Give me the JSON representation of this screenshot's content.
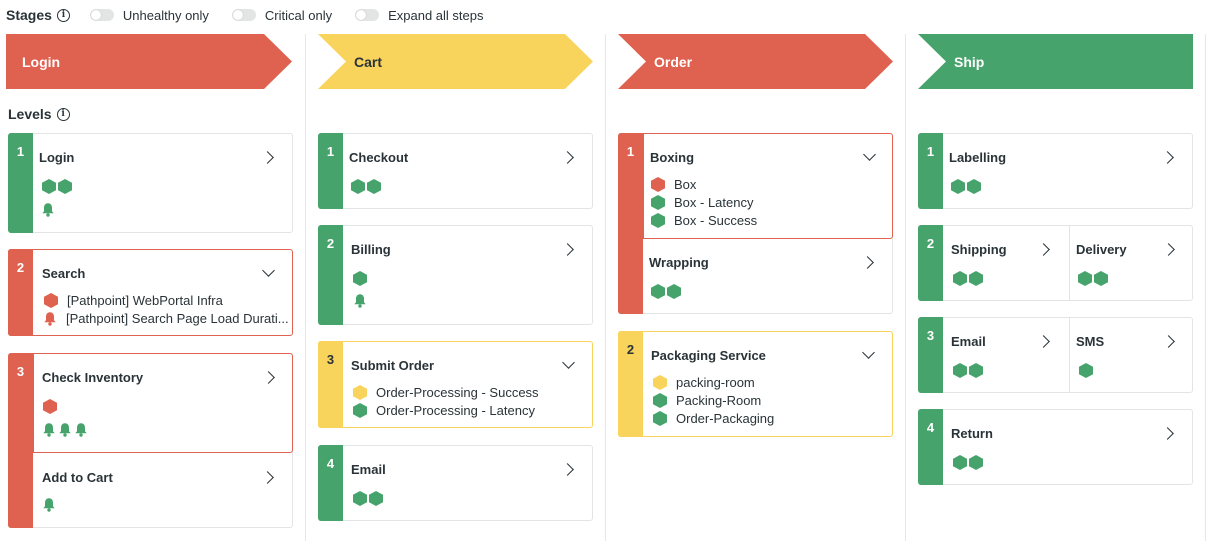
{
  "topbar": {
    "title": "Stages",
    "info_icon": "i",
    "toggles": [
      "Unhealthy only",
      "Critical only",
      "Expand all steps"
    ]
  },
  "levels_label": "Levels",
  "colors": {
    "green": "#47a36c",
    "red": "#df6150",
    "yellow": "#f8d45c"
  },
  "stages": [
    {
      "name": "Login",
      "status": "red"
    },
    {
      "name": "Cart",
      "status": "yellow"
    },
    {
      "name": "Order",
      "status": "red"
    },
    {
      "name": "Ship",
      "status": "green"
    }
  ],
  "login": {
    "l1": {
      "num": "1",
      "step": "Login"
    },
    "l2": {
      "num": "2",
      "step": "Search",
      "items": [
        "[Pathpoint] WebPortal Infra",
        "[Pathpoint] Search Page Load Durati..."
      ]
    },
    "l3": {
      "num": "3",
      "step_a": "Check Inventory",
      "step_b": "Add to Cart"
    }
  },
  "cart": {
    "l1": {
      "num": "1",
      "step": "Checkout"
    },
    "l2": {
      "num": "2",
      "step": "Billing"
    },
    "l3": {
      "num": "3",
      "step": "Submit Order",
      "items": [
        "Order-Processing - Success",
        "Order-Processing - Latency"
      ]
    },
    "l4": {
      "num": "4",
      "step": "Email"
    }
  },
  "order": {
    "l1": {
      "num": "1",
      "step_a": "Boxing",
      "items": [
        "Box",
        "Box - Latency",
        "Box - Success"
      ],
      "step_b": "Wrapping"
    },
    "l2": {
      "num": "2",
      "step": "Packaging Service",
      "items": [
        "packing-room",
        "Packing-Room",
        "Order-Packaging"
      ]
    }
  },
  "ship": {
    "l1": {
      "num": "1",
      "step": "Labelling"
    },
    "l2": {
      "num": "2",
      "step_a": "Shipping",
      "step_b": "Delivery"
    },
    "l3": {
      "num": "3",
      "step_a": "Email",
      "step_b": "SMS"
    },
    "l4": {
      "num": "4",
      "step": "Return"
    }
  }
}
